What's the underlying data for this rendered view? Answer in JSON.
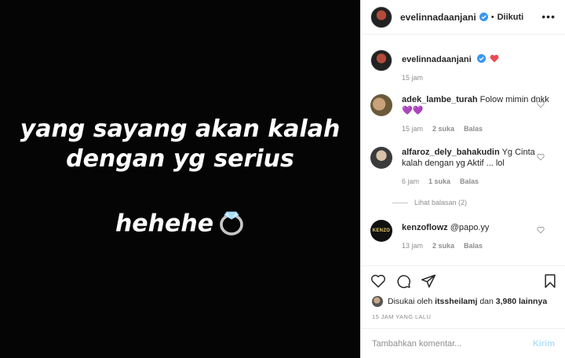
{
  "post": {
    "caption_lines": [
      "yang sayang akan kalah",
      "dengan yg serius"
    ],
    "caption_tail": "hehehe",
    "ring_icon": "ring-emoji-icon"
  },
  "header": {
    "username": "evelinnadaanjani",
    "separator": "•",
    "follow_label": "Diikuti",
    "more_icon": "more-icon"
  },
  "caption_comment": {
    "username": "evelinnadaanjani",
    "time": "15 jam"
  },
  "comments": [
    {
      "username": "adek_lambe_turah",
      "text": "Folow mimin dnkk",
      "emoji": "💜💜",
      "time": "15 jam",
      "likes": "2 suka",
      "reply": "Balas"
    },
    {
      "username": "alfaroz_dely_bahakudin",
      "text": "Yg Cinta kalah dengan yg Aktif ... lol",
      "emoji": "",
      "time": "6 jam",
      "likes": "1 suka",
      "reply": "Balas"
    },
    {
      "username": "kenzoflowz",
      "text": "@papo.yy",
      "emoji": "",
      "time": "13 jam",
      "likes": "2 suka",
      "reply": "Balas"
    }
  ],
  "view_replies": "Lihat balasan (2)",
  "kenzo_avatar_text": "KENZO",
  "actions": {
    "liked_by_prefix": "Disukai oleh",
    "liked_by_user": "itssheilamj",
    "liked_by_mid": "dan",
    "liked_by_count": "3,980 lainnya",
    "time_ago": "15 JAM YANG LALU"
  },
  "add_comment": {
    "placeholder": "Tambahkan komentar...",
    "send_label": "Kirim"
  },
  "colors": {
    "verified": "#3897f0",
    "heart": "#ed4956",
    "send_disabled": "#b2dffc"
  }
}
